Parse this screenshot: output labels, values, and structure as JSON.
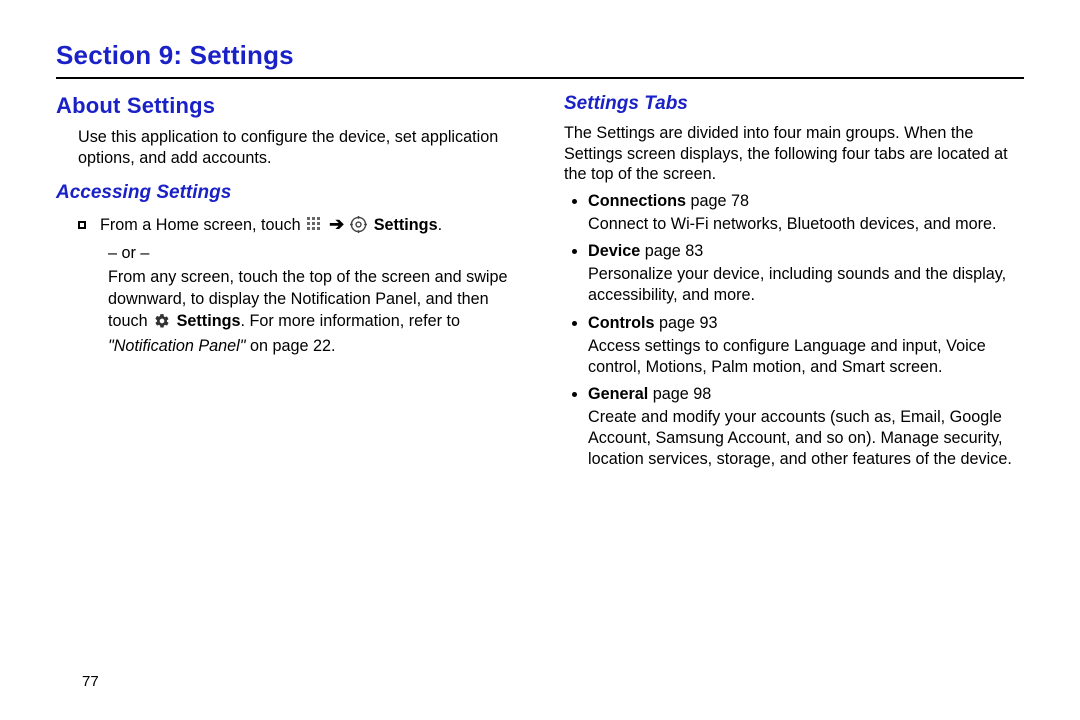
{
  "section_title": "Section 9: Settings",
  "page_number": "77",
  "left": {
    "heading": "About Settings",
    "intro": "Use this application to configure the device, set application options, and add accounts.",
    "sub_heading": "Accessing Settings",
    "line1_pre": "From a Home screen, touch ",
    "line1_post": " Settings",
    "line1_period": ".",
    "or": "– or –",
    "line2a": "From any screen, touch the top of the screen and swipe downward, to display the Notification Panel, and then touch ",
    "line2_settings": "Settings",
    "line2b": ". For more information, refer to ",
    "line2_ref": "\"Notification Panel\"",
    "line2_pg": " on page 22."
  },
  "right": {
    "sub_heading": "Settings Tabs",
    "intro": "The Settings are divided into four main groups. When the Settings screen displays, the following four tabs are located at the top of the screen.",
    "tabs": [
      {
        "name": "Connections",
        "page": " page 78",
        "desc": "Connect to Wi-Fi networks, Bluetooth devices, and more."
      },
      {
        "name": "Device",
        "page": " page 83",
        "desc": "Personalize your device, including sounds and the display, accessibility, and more."
      },
      {
        "name": "Controls",
        "page": " page 93",
        "desc": "Access settings to configure Language and input, Voice control, Motions, Palm motion, and Smart screen."
      },
      {
        "name": "General",
        "page": " page 98",
        "desc": "Create and modify your accounts (such as, Email, Google Account, Samsung Account, and so on). Manage security, location services, storage, and other features of the device."
      }
    ]
  }
}
